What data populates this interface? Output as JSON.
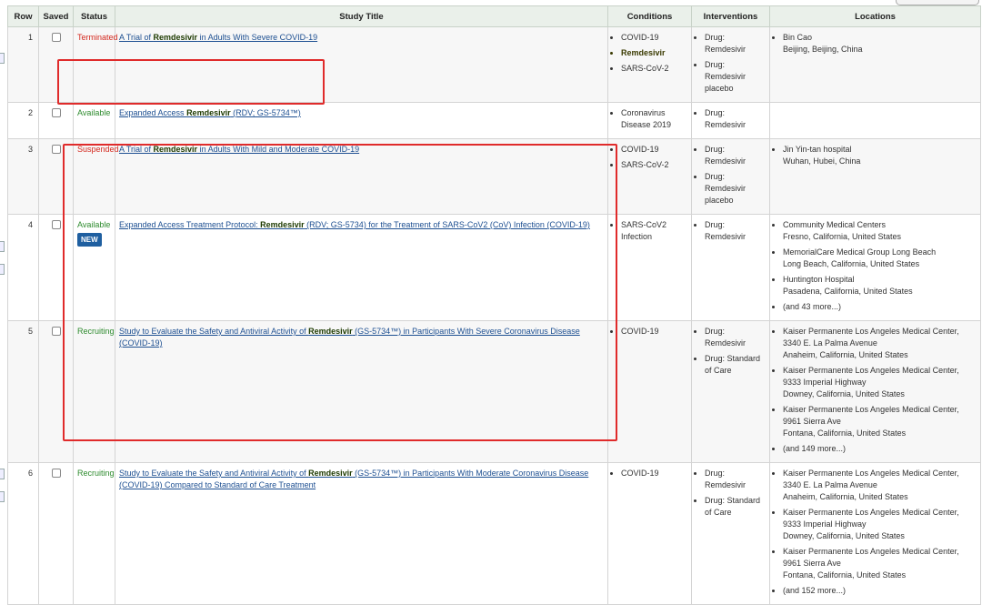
{
  "headers": {
    "row": "Row",
    "saved": "Saved",
    "status": "Status",
    "title": "Study Title",
    "conditions": "Conditions",
    "interventions": "Interventions",
    "locations": "Locations"
  },
  "rows": [
    {
      "num": "1",
      "status": "Terminated",
      "badge": "",
      "title_pre": "A Trial of ",
      "title_kw": "Remdesivir",
      "title_post": " in Adults With Severe COVID-19",
      "conditions": [
        "COVID-19",
        "Remdesivir",
        "SARS-CoV-2"
      ],
      "interventions": [
        "Drug: Remdesivir",
        "Drug: Remdesivir placebo"
      ],
      "locations": [
        {
          "name": "Bin Cao",
          "addr": "Beijing, Beijing, China"
        }
      ]
    },
    {
      "num": "2",
      "status": "Available",
      "badge": "",
      "title_pre": "Expanded Access ",
      "title_kw": "Remdesivir",
      "title_post": " (RDV; GS-5734™)",
      "conditions": [
        "Coronavirus Disease 2019"
      ],
      "interventions": [
        "Drug: Remdesivir"
      ],
      "locations": []
    },
    {
      "num": "3",
      "status": "Suspended",
      "badge": "",
      "title_pre": "A Trial of ",
      "title_kw": "Remdesivir",
      "title_post": " in Adults With Mild and Moderate COVID-19",
      "conditions": [
        "COVID-19",
        "SARS-CoV-2"
      ],
      "interventions": [
        "Drug: Remdesivir",
        "Drug: Remdesivir placebo"
      ],
      "locations": [
        {
          "name": "Jin Yin-tan hospital",
          "addr": "Wuhan, Hubei, China"
        }
      ]
    },
    {
      "num": "4",
      "status": "Available",
      "badge": "NEW",
      "title_pre": "Expanded Access Treatment Protocol: ",
      "title_kw": "Remdesivir",
      "title_post": " (RDV; GS-5734) for the Treatment of SARS-CoV2 (CoV) Infection (COVID-19)",
      "conditions": [
        "SARS-CoV2 Infection"
      ],
      "interventions": [
        "Drug: Remdesivir"
      ],
      "locations": [
        {
          "name": "Community Medical Centers",
          "addr": "Fresno, California, United States"
        },
        {
          "name": "MemorialCare Medical Group Long Beach",
          "addr": "Long Beach, California, United States"
        },
        {
          "name": "Huntington Hospital",
          "addr": "Pasadena, California, United States"
        },
        {
          "name": "(and 43 more...)",
          "addr": ""
        }
      ]
    },
    {
      "num": "5",
      "status": "Recruiting",
      "badge": "",
      "title_pre": "Study to Evaluate the Safety and Antiviral Activity of ",
      "title_kw": "Remdesivir",
      "title_post": " (GS-5734™) in Participants With Severe Coronavirus Disease (COVID-19)",
      "conditions": [
        "COVID-19"
      ],
      "interventions": [
        "Drug: Remdesivir",
        "Drug: Standard of Care"
      ],
      "locations": [
        {
          "name": "Kaiser Permanente Los Angeles Medical Center, 3340 E. La Palma Avenue",
          "addr": "Anaheim, California, United States"
        },
        {
          "name": "Kaiser Permanente Los Angeles Medical Center, 9333 Imperial Highway",
          "addr": "Downey, California, United States"
        },
        {
          "name": "Kaiser Permanente Los Angeles Medical Center, 9961 Sierra Ave",
          "addr": "Fontana, California, United States"
        },
        {
          "name": "(and 149 more...)",
          "addr": ""
        }
      ]
    },
    {
      "num": "6",
      "status": "Recruiting",
      "badge": "",
      "title_pre": "Study to Evaluate the Safety and Antiviral Activity of ",
      "title_kw": "Remdesivir",
      "title_post": " (GS-5734™) in Participants With Moderate Coronavirus Disease (COVID-19) Compared to Standard of Care Treatment",
      "conditions": [
        "COVID-19"
      ],
      "interventions": [
        "Drug: Remdesivir",
        "Drug: Standard of Care"
      ],
      "locations": [
        {
          "name": "Kaiser Permanente Los Angeles Medical Center, 3340 E. La Palma Avenue",
          "addr": "Anaheim, California, United States"
        },
        {
          "name": "Kaiser Permanente Los Angeles Medical Center, 9333 Imperial Highway",
          "addr": "Downey, California, United States"
        },
        {
          "name": "Kaiser Permanente Los Angeles Medical Center, 9961 Sierra Ave",
          "addr": "Fontana, California, United States"
        },
        {
          "name": "(and 152 more...)",
          "addr": ""
        }
      ]
    }
  ],
  "colors": {
    "status_red": "#d42a20",
    "status_green": "#2e8b2e",
    "link": "#1d4f91",
    "annotation_box": "#e02b2b",
    "header_bg": "#eaf0ea"
  }
}
